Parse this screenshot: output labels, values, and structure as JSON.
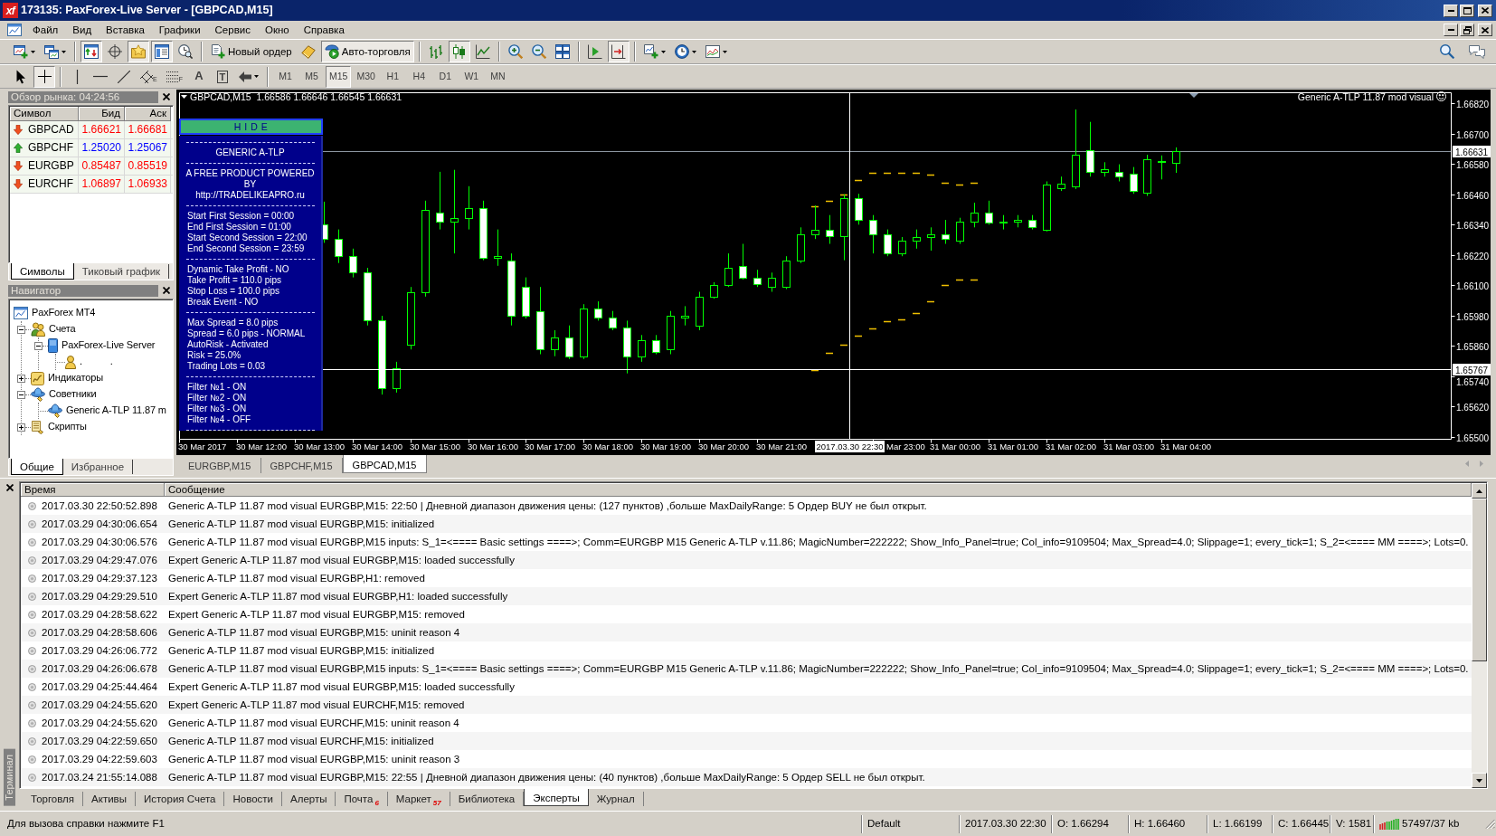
{
  "window": {
    "logo": "xf",
    "title": "173135: PaxForex-Live Server - [GBPCAD,M15]"
  },
  "menu": [
    "Файл",
    "Вид",
    "Вставка",
    "Графики",
    "Сервис",
    "Окно",
    "Справка"
  ],
  "toolbar": [
    {
      "kind": "button",
      "on": false,
      "dropdown": true
    },
    {
      "kind": "button",
      "on": false,
      "dropdown": true
    },
    {
      "kind": "separator"
    },
    {
      "kind": "button",
      "on": true
    },
    {
      "kind": "button",
      "on": false
    },
    {
      "kind": "button",
      "on": true
    },
    {
      "kind": "button",
      "on": true
    },
    {
      "kind": "button",
      "on": false
    },
    {
      "kind": "separator"
    },
    {
      "kind": "button",
      "label": "Новый ордер",
      "on": false
    },
    {
      "kind": "button",
      "on": false
    },
    {
      "kind": "button",
      "label": "Авто-торговля",
      "on": true
    },
    {
      "kind": "separator"
    },
    {
      "kind": "button",
      "on": false
    },
    {
      "kind": "button",
      "on": true
    },
    {
      "kind": "button",
      "on": false
    },
    {
      "kind": "separator"
    },
    {
      "kind": "button",
      "on": false
    },
    {
      "kind": "button",
      "on": false
    },
    {
      "kind": "button",
      "on": false
    },
    {
      "kind": "separator"
    },
    {
      "kind": "button",
      "on": false
    },
    {
      "kind": "button",
      "on": true
    },
    {
      "kind": "separator"
    },
    {
      "kind": "button",
      "on": false,
      "dropdown": true
    },
    {
      "kind": "button",
      "on": false,
      "dropdown": true
    },
    {
      "kind": "button",
      "on": false,
      "dropdown": true
    }
  ],
  "tools": [
    {
      "kind": "icon",
      "selected": false
    },
    {
      "kind": "icon",
      "selected": true
    },
    {
      "kind": "separator"
    },
    {
      "kind": "icon",
      "selected": false
    },
    {
      "kind": "icon",
      "selected": false
    },
    {
      "kind": "icon",
      "selected": false
    },
    {
      "kind": "subscript",
      "label": "E",
      "selected": false
    },
    {
      "kind": "subscript",
      "label": "F",
      "selected": false
    },
    {
      "kind": "letter",
      "label": "A",
      "selected": false
    },
    {
      "kind": "boxed",
      "label": "T",
      "selected": false
    },
    {
      "kind": "icon",
      "selected": false,
      "dropdown": true
    }
  ],
  "timeframes": [
    {
      "label": "M1",
      "selected": false
    },
    {
      "label": "M5",
      "selected": false
    },
    {
      "label": "M15",
      "selected": true
    },
    {
      "label": "M30",
      "selected": false
    },
    {
      "label": "H1",
      "selected": false
    },
    {
      "label": "H4",
      "selected": false
    },
    {
      "label": "D1",
      "selected": false
    },
    {
      "label": "W1",
      "selected": false
    },
    {
      "label": "MN",
      "selected": false
    }
  ],
  "market_watch": {
    "title": "Обзор рынка: 04:24:56",
    "columns": [
      "Символ",
      "Бид",
      "Аск"
    ],
    "rows": [
      {
        "symbol": "GBPCAD",
        "bid": "1.66621",
        "ask": "1.66681",
        "rising": false
      },
      {
        "symbol": "GBPCHF",
        "bid": "1.25020",
        "ask": "1.25067",
        "rising": true
      },
      {
        "symbol": "EURGBP",
        "bid": "0.85487",
        "ask": "0.85519",
        "rising": false
      },
      {
        "symbol": "EURCHF",
        "bid": "1.06897",
        "ask": "1.06933",
        "rising": false
      }
    ],
    "tabs": [
      {
        "label": "Символы",
        "selected": true
      },
      {
        "label": "Тиковый график",
        "selected": false
      }
    ]
  },
  "navigator": {
    "title": "Навигатор",
    "tree": [
      {
        "kind": "terminal",
        "label": "PaxForex MT4",
        "children": [
          {
            "kind": "accounts",
            "label": "Счета",
            "expanded": true,
            "children": [
              {
                "kind": "server",
                "label": "PaxForex-Live Server",
                "expanded": true,
                "children": [
                  {
                    "kind": "account",
                    "label": ". ."
                  }
                ]
              }
            ]
          },
          {
            "kind": "indicators",
            "label": "Индикаторы",
            "expanded": false
          },
          {
            "kind": "experts",
            "label": "Советники",
            "expanded": true,
            "children": [
              {
                "kind": "expert",
                "label": "Generic A-TLP 11.87 m"
              }
            ]
          },
          {
            "kind": "scripts",
            "label": "Скрипты",
            "expanded": false
          }
        ]
      }
    ],
    "tabs": [
      {
        "label": "Общие",
        "selected": true
      },
      {
        "label": "Избранное",
        "selected": false
      }
    ]
  },
  "chart": {
    "title": "GBPCAD,M15  1.66586 1.66646 1.66545 1.66631",
    "expert": "Generic A-TLP 11.87 mod visual",
    "info_panel": {
      "button": "H I D E",
      "sections": [
        {
          "centered": true,
          "lines": [
            "GENERIC A-TLP"
          ]
        },
        {
          "centered": true,
          "lines": [
            "A FREE PRODUCT POWERED",
            "BY",
            "http://TRADELIKEAPRO.ru"
          ]
        },
        {
          "centered": false,
          "lines": [
            "Start First Session = 00:00",
            "End First Session = 01:00",
            "Start Second Session = 22:00",
            "End Second Session = 23:59"
          ]
        },
        {
          "centered": false,
          "lines": [
            "Dynamic Take Profit - NO",
            "Take Profit = 110.0 pips",
            "Stop Loss = 100.0 pips",
            "Break Event - NO"
          ]
        },
        {
          "centered": false,
          "lines": [
            "Max Spread = 8.0 pips",
            "Spread = 6.0 pips - NORMAL",
            "AutoRisk - Activated",
            "Risk = 25.0%",
            "Trading Lots = 0.03"
          ]
        },
        {
          "centered": false,
          "lines": [
            "Filter №1 - ON",
            "Filter №2 - ON",
            "Filter №3 - ON",
            "Filter №4 - OFF"
          ]
        }
      ]
    },
    "price_axis": [
      "1.66820",
      "1.66700",
      "1.66580",
      "1.66460",
      "1.66340",
      "1.66220",
      "1.66100",
      "1.65980",
      "1.65860",
      "1.65740",
      "1.65620",
      "1.65500"
    ],
    "time_axis": [
      "30 Mar 2017",
      "30 Mar 12:00",
      "30 Mar 13:00",
      "30 Mar 14:00",
      "30 Mar 15:00",
      "30 Mar 16:00",
      "30 Mar 17:00",
      "30 Mar 18:00",
      "30 Mar 19:00",
      "30 Mar 20:00",
      "30 Mar 21:00",
      "Mar 23:00",
      "31 Mar 00:00",
      "31 Mar 01:00",
      "31 Mar 02:00",
      "31 Mar 03:00",
      "31 Mar 04:00"
    ],
    "bid_price": "1.66631",
    "crosshair_time": "2017.03.30 22:30",
    "crosshair_price": "1.65767"
  },
  "chart_tabs": [
    {
      "label": "EURGBP,M15",
      "selected": false
    },
    {
      "label": "GBPCHF,M15",
      "selected": false
    },
    {
      "label": "GBPCAD,M15",
      "selected": true
    }
  ],
  "terminal": {
    "side_label": "Терминал",
    "columns": [
      "Время",
      "Сообщение"
    ],
    "rows": [
      {
        "time": "2017.03.30 22:50:52.898",
        "message": "Generic A-TLP 11.87 mod visual EURGBP,M15: 22:50 | Дневной диапазон движения цены: (127 пунктов) ,больше MaxDailyRange: 5 Ордер BUY не был открыт."
      },
      {
        "time": "2017.03.29 04:30:06.654",
        "message": "Generic A-TLP 11.87 mod visual EURGBP,M15: initialized"
      },
      {
        "time": "2017.03.29 04:30:06.576",
        "message": "Generic A-TLP 11.87 mod visual EURGBP,M15 inputs: S_1=<==== Basic settings ====>; Comm=EURGBP M15 Generic A-TLP v.11.86; MagicNumber=222222; Show_Info_Panel=true; Col_info=9109504; Max_Spread=4.0; Slippage=1; every_tick=1; S_2=<==== MM ====>; Lots=0."
      },
      {
        "time": "2017.03.29 04:29:47.076",
        "message": "Expert Generic A-TLP 11.87 mod visual EURGBP,M15: loaded successfully"
      },
      {
        "time": "2017.03.29 04:29:37.123",
        "message": "Generic A-TLP 11.87 mod visual EURGBP,H1: removed"
      },
      {
        "time": "2017.03.29 04:29:29.510",
        "message": "Expert Generic A-TLP 11.87 mod visual EURGBP,H1: loaded successfully"
      },
      {
        "time": "2017.03.29 04:28:58.622",
        "message": "Expert Generic A-TLP 11.87 mod visual EURGBP,M15: removed"
      },
      {
        "time": "2017.03.29 04:28:58.606",
        "message": "Generic A-TLP 11.87 mod visual EURGBP,M15: uninit reason 4"
      },
      {
        "time": "2017.03.29 04:26:06.772",
        "message": "Generic A-TLP 11.87 mod visual EURGBP,M15: initialized"
      },
      {
        "time": "2017.03.29 04:26:06.678",
        "message": "Generic A-TLP 11.87 mod visual EURGBP,M15 inputs: S_1=<==== Basic settings ====>; Comm=EURGBP M15 Generic A-TLP v.11.86; MagicNumber=222222; Show_Info_Panel=true; Col_info=9109504; Max_Spread=4.0; Slippage=1; every_tick=1; S_2=<==== MM ====>; Lots=0."
      },
      {
        "time": "2017.03.29 04:25:44.464",
        "message": "Expert Generic A-TLP 11.87 mod visual EURGBP,M15: loaded successfully"
      },
      {
        "time": "2017.03.29 04:24:55.620",
        "message": "Expert Generic A-TLP 11.87 mod visual EURCHF,M15: removed"
      },
      {
        "time": "2017.03.29 04:24:55.620",
        "message": "Generic A-TLP 11.87 mod visual EURCHF,M15: uninit reason 4"
      },
      {
        "time": "2017.03.29 04:22:59.650",
        "message": "Generic A-TLP 11.87 mod visual EURCHF,M15: initialized"
      },
      {
        "time": "2017.03.29 04:22:59.603",
        "message": "Generic A-TLP 11.87 mod visual EURGBP,M15: uninit reason 3"
      },
      {
        "time": "2017.03.24 21:55:14.088",
        "message": "Generic A-TLP 11.87 mod visual EURGBP,M15: 22:55 | Дневной диапазон движения цены: (40 пунктов) ,больше MaxDailyRange: 5 Ордер SELL не был открыт."
      }
    ],
    "tabs": [
      {
        "label": "Торговля",
        "selected": false
      },
      {
        "label": "Активы",
        "selected": false
      },
      {
        "label": "История Счета",
        "selected": false
      },
      {
        "label": "Новости",
        "selected": false
      },
      {
        "label": "Алерты",
        "selected": false
      },
      {
        "label": "Почта",
        "badge": "6",
        "selected": false
      },
      {
        "label": "Маркет",
        "badge": "57",
        "selected": false
      },
      {
        "label": "Библиотека",
        "selected": false
      },
      {
        "label": "Эксперты",
        "selected": true
      },
      {
        "label": "Журнал",
        "selected": false
      }
    ]
  },
  "status_bar": {
    "help": "Для вызова справки нажмите F1",
    "profile": "Default",
    "time": "2017.03.30 22:30",
    "open": "O: 1.66294",
    "high": "H: 1.66460",
    "low": "L: 1.66199",
    "close": "C: 1.66445",
    "volume": "V: 1581",
    "traffic": "57497/37 kb"
  }
}
